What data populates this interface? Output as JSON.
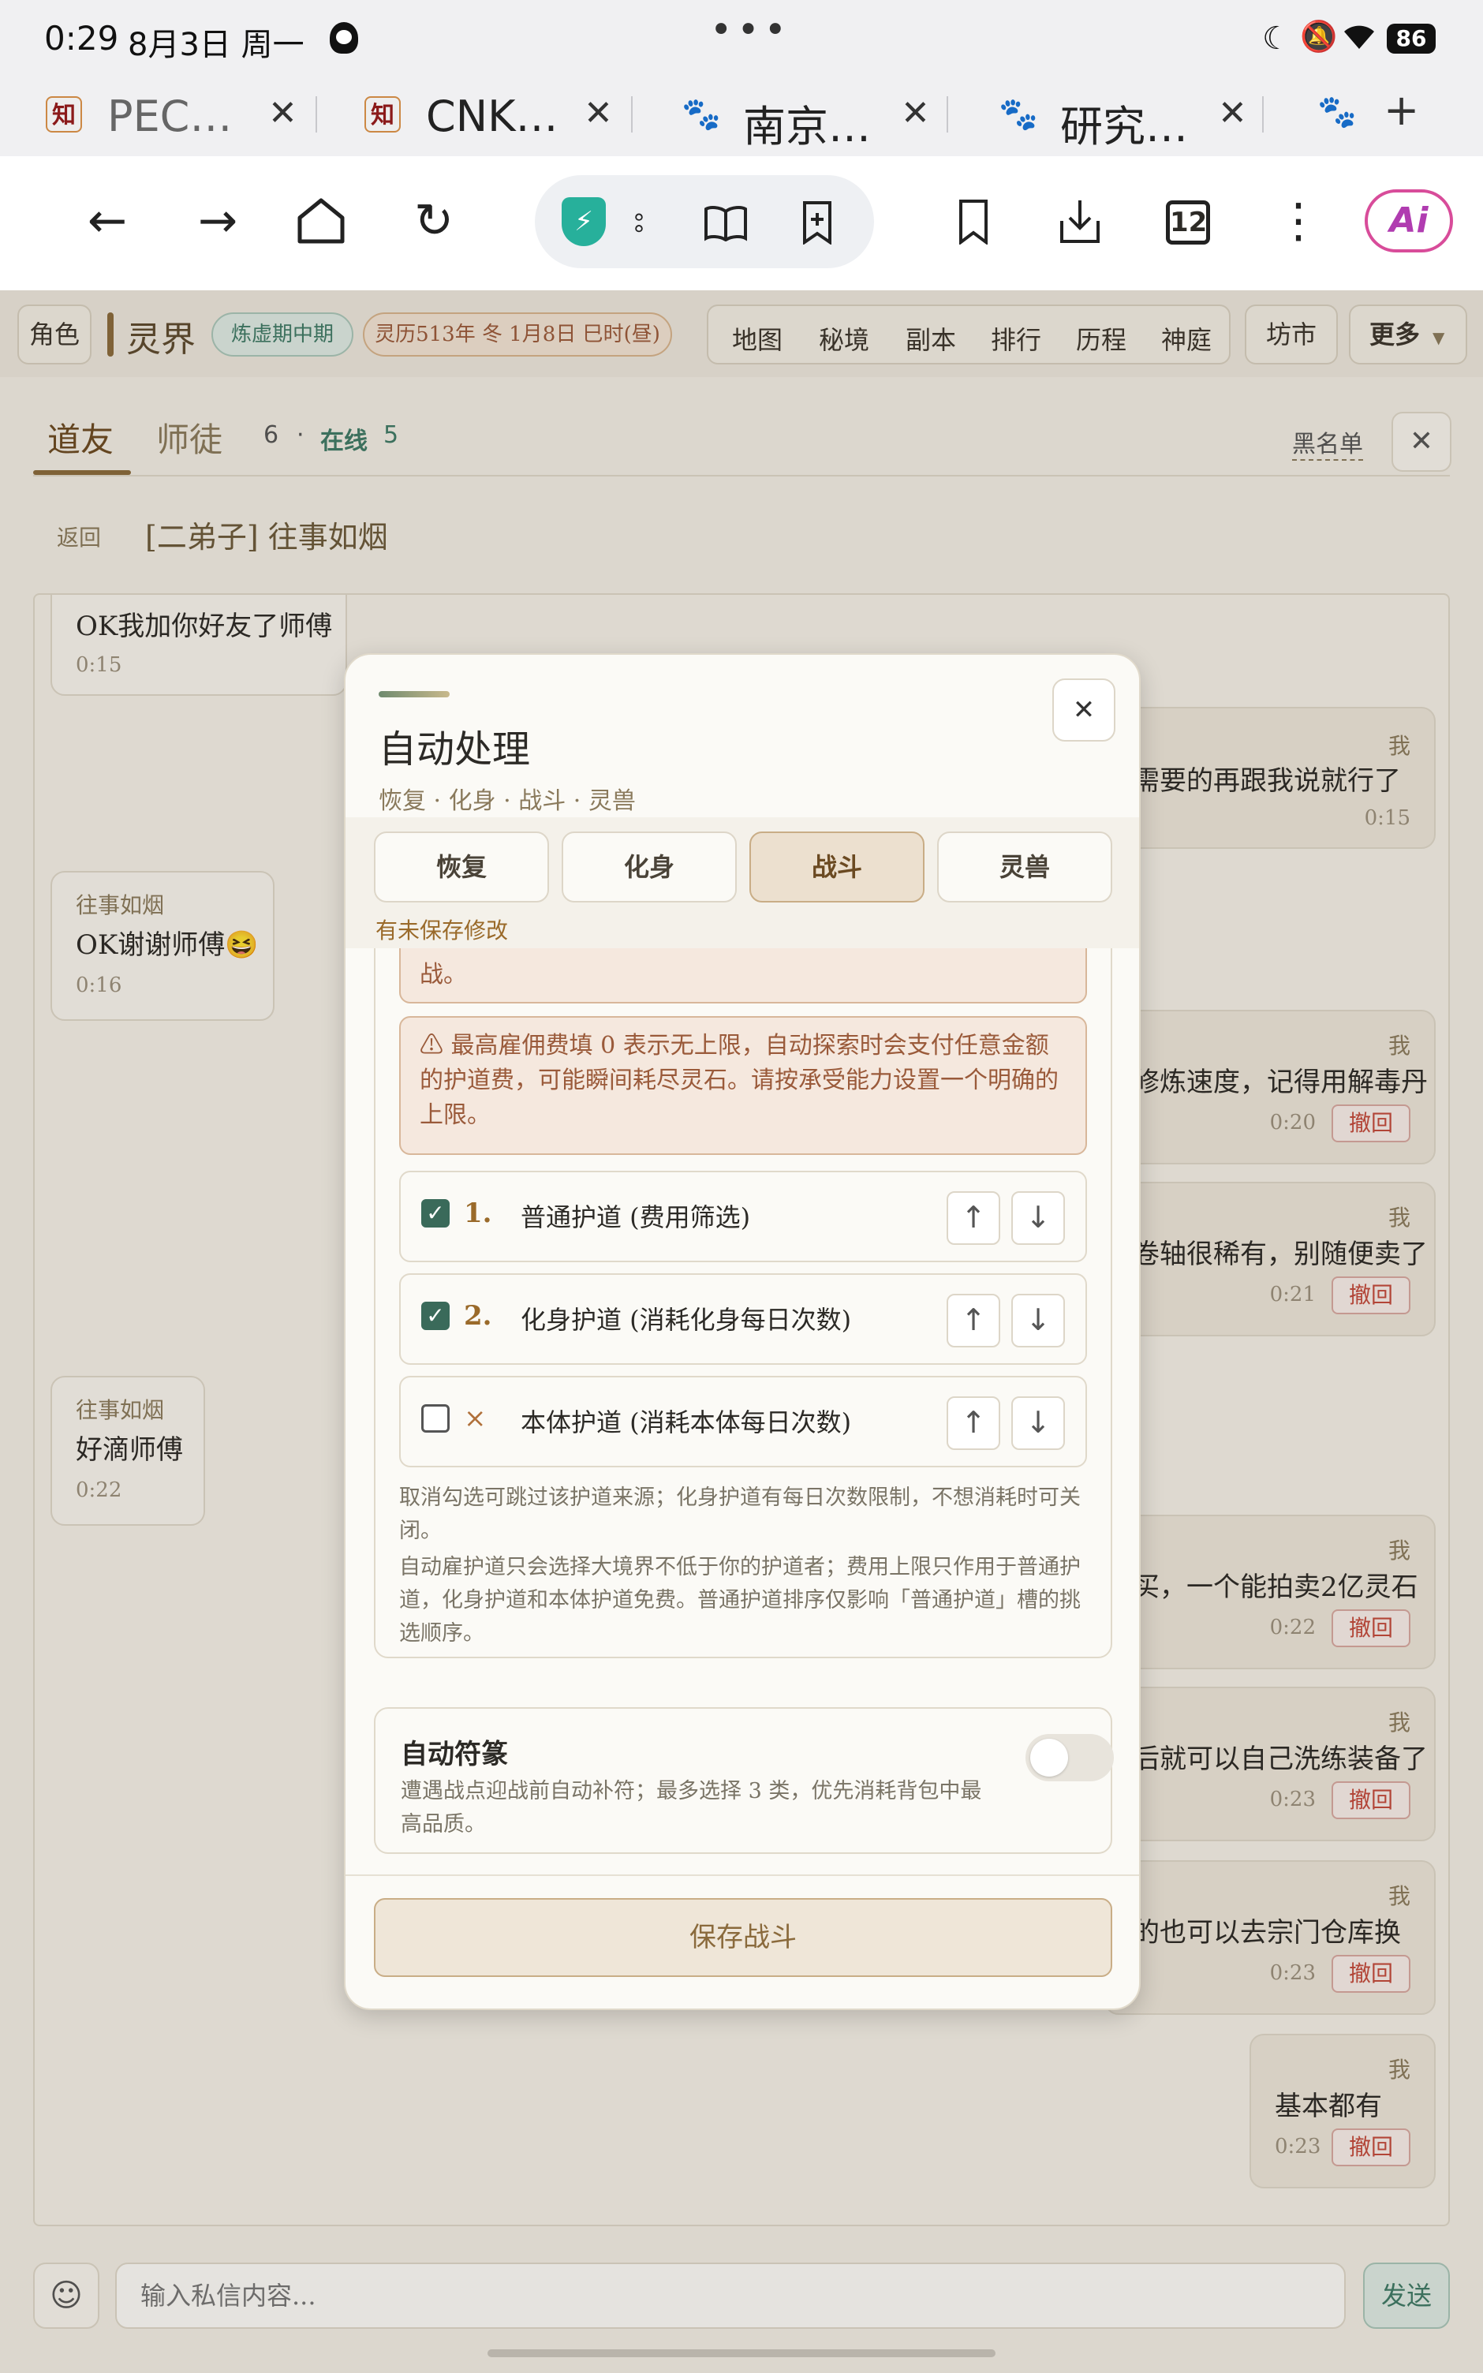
{
  "status_bar": {
    "time": "0:29",
    "date": "8月3日 周一",
    "battery": "86"
  },
  "browser_tabs": [
    {
      "title": "PEC…",
      "favicon": "知"
    },
    {
      "title": "CNK…",
      "favicon": "知"
    },
    {
      "title": "南京…",
      "favicon": "paw-icon"
    },
    {
      "title": "研究…",
      "favicon": "paw-icon"
    }
  ],
  "toolbar": {
    "tab_count": "12",
    "ai_label": "Ai"
  },
  "game_header": {
    "role_btn": "角色",
    "realm": "灵界",
    "stage_badge": "炼虚期中期",
    "date_badge": "灵历513年 冬 1月8日 巳时(昼)",
    "nav": [
      "地图",
      "秘境",
      "副本",
      "排行",
      "历程",
      "神庭"
    ],
    "market": "坊市",
    "more": "更多"
  },
  "chat": {
    "tabs": [
      "道友",
      "师徒"
    ],
    "count": "6",
    "dot": "·",
    "online_label": "在线",
    "online_count": "5",
    "blacklist": "黑名单",
    "back": "返回",
    "conversation": "[二弟子] 往事如烟",
    "me_label": "我",
    "revoke_label": "撤回",
    "messages": [
      {
        "who": "",
        "text": "OK我加你好友了师傅",
        "time": "0:15"
      },
      {
        "who": "我",
        "text": "…需要的再跟我说就行了",
        "time": "0:15"
      },
      {
        "who": "往事如烟",
        "text": "OK谢谢师傅😆",
        "time": "0:16"
      },
      {
        "who": "我",
        "text": "…修炼速度，记得用解毒丹",
        "time": "0:20"
      },
      {
        "who": "我",
        "text": "…卷轴很稀有，别随便卖了",
        "time": "0:21"
      },
      {
        "who": "往事如烟",
        "text": "好滴师傅",
        "time": "0:22"
      },
      {
        "who": "我",
        "text": "…买，一个能拍卖2亿灵石",
        "time": "0:22"
      },
      {
        "who": "我",
        "text": "…后就可以自己洗练装备了",
        "time": "0:23"
      },
      {
        "who": "我",
        "text": "…的也可以去宗门仓库换",
        "time": "0:23"
      },
      {
        "who": "我",
        "text": "基本都有",
        "time": "0:23"
      }
    ],
    "input_placeholder": "输入私信内容...",
    "send": "发送"
  },
  "modal": {
    "title": "自动处理",
    "subtitle": "恢复 · 化身 · 战斗 · 灵兽",
    "tabs": [
      "恢复",
      "化身",
      "战斗",
      "灵兽"
    ],
    "active_tab": "战斗",
    "unsaved": "有未保存修改",
    "warning_top_tail": "战。",
    "warning_zero": "⚠ 最高雇佣费填 0 表示无上限，自动探索时会支付任意金额的护道费，可能瞬间耗尽灵石。请按承受能力设置一个明确的上限。",
    "guard_rows": [
      {
        "checked": true,
        "num": "1.",
        "label": "普通护道 (费用筛选)"
      },
      {
        "checked": true,
        "num": "2.",
        "label": "化身护道 (消耗化身每日次数)"
      },
      {
        "checked": false,
        "num": "×",
        "label": "本体护道 (消耗本体每日次数)"
      }
    ],
    "note1": "取消勾选可跳过该护道来源；化身护道有每日次数限制，不想消耗时可关闭。",
    "note2": "自动雇护道只会选择大境界不低于你的护道者；费用上限只作用于普通护道，化身护道和本体护道免费。普通护道排序仅影响「普通护道」槽的挑选顺序。",
    "auto_talisman_title": "自动符篆",
    "auto_talisman_desc": "遭遇战点迎战前自动补符；最多选择 3 类，优先消耗背包中最高品质。",
    "auto_talisman_on": false,
    "save": "保存战斗"
  }
}
